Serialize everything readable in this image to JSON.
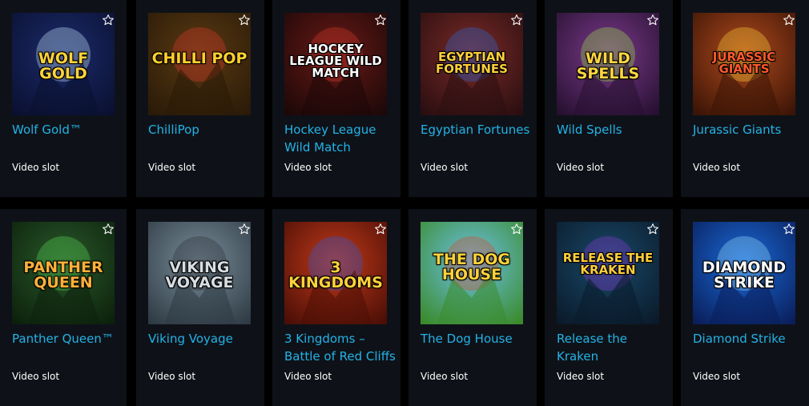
{
  "games": [
    {
      "name": "Wolf Gold™",
      "type": "Video slot",
      "art": "WOLF GOLD",
      "icon": "wolf-gold-thumbnail",
      "bg": [
        "#1c2b6b",
        "#0a1030"
      ],
      "fg": "#ffd33a",
      "accent": "#c9e9ff"
    },
    {
      "name": "ChilliPop",
      "type": "Video slot",
      "art": "CHILLI POP",
      "icon": "chillipop-thumbnail",
      "bg": [
        "#5a3a12",
        "#2a1a08"
      ],
      "fg": "#ffcf2b",
      "accent": "#e03a2a"
    },
    {
      "name": "Hockey League Wild Match",
      "type": "Video slot",
      "art": "HOCKEY LEAGUE WILD MATCH",
      "icon": "hockey-league-thumbnail",
      "bg": [
        "#6a1a16",
        "#1c0808"
      ],
      "fg": "#ffffff",
      "accent": "#d63a2a"
    },
    {
      "name": "Egyptian Fortunes",
      "type": "Video slot",
      "art": "EGYPTIAN FORTUNES",
      "icon": "egyptian-fortunes-thumbnail",
      "bg": [
        "#7a2a28",
        "#2a0e10"
      ],
      "fg": "#ffcf3a",
      "accent": "#2a6ad8"
    },
    {
      "name": "Wild Spells",
      "type": "Video slot",
      "art": "WILD SPELLS",
      "icon": "wild-spells-thumbnail",
      "bg": [
        "#7a3a8a",
        "#261030"
      ],
      "fg": "#ffd640",
      "accent": "#9adf4a"
    },
    {
      "name": "Jurassic Giants",
      "type": "Video slot",
      "art": "JURASSIC GIANTS",
      "icon": "jurassic-giants-thumbnail",
      "bg": [
        "#b04a1c",
        "#3a1406"
      ],
      "fg": "#ff5a2a",
      "accent": "#ffd23a"
    },
    {
      "name": "Panther Queen™",
      "type": "Video slot",
      "art": "PANTHER QUEEN",
      "icon": "panther-queen-thumbnail",
      "bg": [
        "#2a5a2a",
        "#0c200c"
      ],
      "fg": "#ffb03a",
      "accent": "#5ad65a"
    },
    {
      "name": "Viking Voyage",
      "type": "Video slot",
      "art": "VIKING VOYAGE",
      "icon": "viking-voyage-thumbnail",
      "bg": [
        "#7a8e9a",
        "#2e3a44"
      ],
      "fg": "#d8dde2",
      "accent": "#2a2f36"
    },
    {
      "name": "3 Kingdoms – Battle of Red Cliffs",
      "type": "Video slot",
      "art": "3 KINGDOMS",
      "icon": "three-kingdoms-thumbnail",
      "bg": [
        "#c23a1a",
        "#4a0e06"
      ],
      "fg": "#ffd23a",
      "accent": "#2a5ad8"
    },
    {
      "name": "The Dog House",
      "type": "Video slot",
      "art": "THE DOG HOUSE",
      "icon": "dog-house-thumbnail",
      "bg": [
        "#6cc2e8",
        "#3a8a2a"
      ],
      "fg": "#ffd23a",
      "accent": "#d8482a"
    },
    {
      "name": "Release the Kraken",
      "type": "Video slot",
      "art": "RELEASE THE KRAKEN",
      "icon": "release-kraken-thumbnail",
      "bg": [
        "#1a4a6a",
        "#0a1a2a"
      ],
      "fg": "#ffcf3a",
      "accent": "#8a3ad8"
    },
    {
      "name": "Diamond Strike",
      "type": "Video slot",
      "art": "DIAMOND STRIKE",
      "icon": "diamond-strike-thumbnail",
      "bg": [
        "#1a6ad8",
        "#0a1e5a"
      ],
      "fg": "#ffffff",
      "accent": "#9adfff"
    }
  ],
  "favorite_icon": "star-outline-icon",
  "colors": {
    "name_link": "#24b2e6",
    "card_bg": "#0e1218",
    "page_bg": "#000000"
  }
}
